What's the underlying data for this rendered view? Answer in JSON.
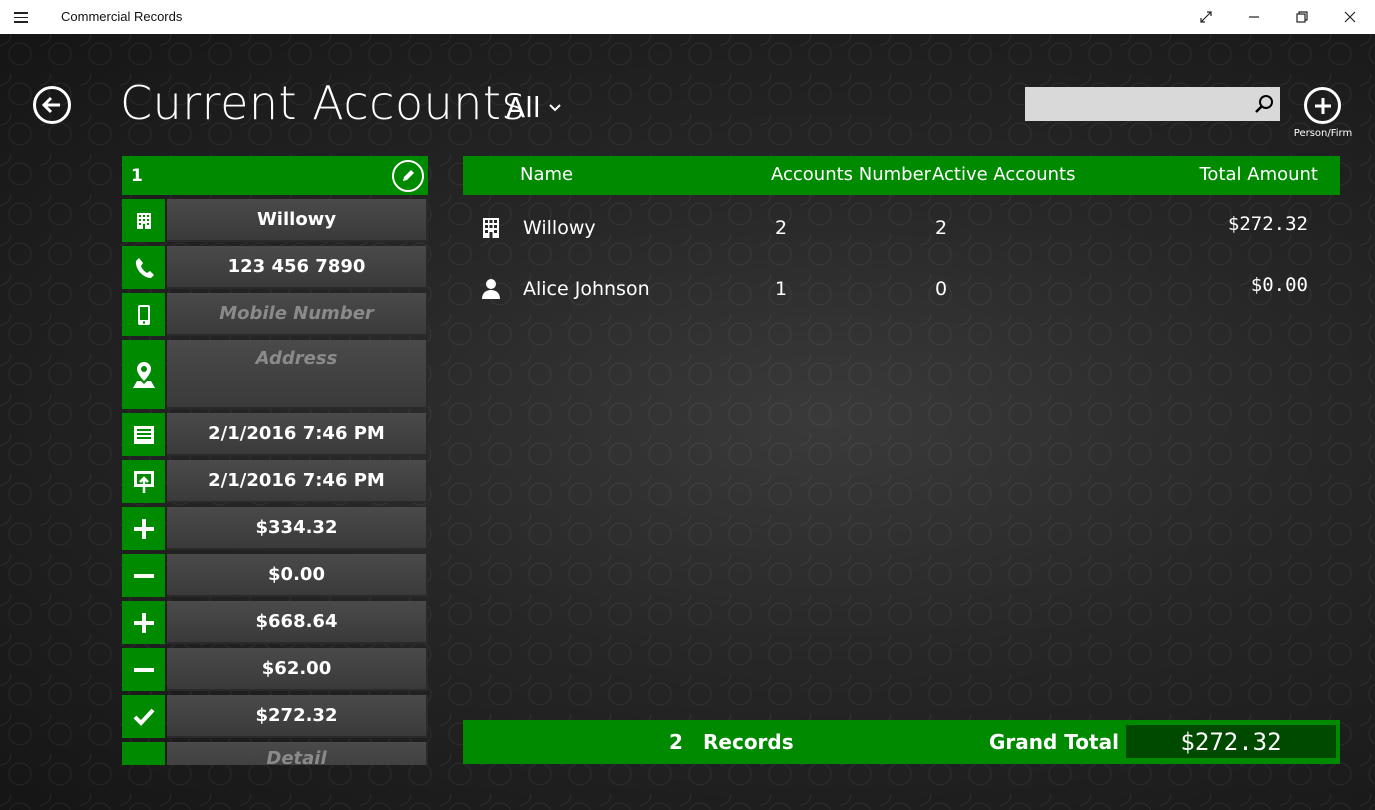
{
  "window": {
    "title": "Commercial Records",
    "icons": [
      "hamburger-icon",
      "expand-icon",
      "minimize-icon",
      "restore-icon",
      "close-icon"
    ]
  },
  "header": {
    "title": "Current Accounts",
    "filter": "All",
    "search_placeholder": "",
    "add_label": "Person/Firm"
  },
  "detail": {
    "id": "1",
    "name": "Willowy",
    "phone": "123 456 7890",
    "mobile_placeholder": "Mobile Number",
    "address_placeholder": "Address",
    "created": "2/1/2016 7:46 PM",
    "updated": "2/1/2016 7:46 PM",
    "credit1": "$334.32",
    "debit1": "$0.00",
    "credit2": "$668.64",
    "debit2": "$62.00",
    "balance": "$272.32",
    "detail_label": "Detail"
  },
  "table": {
    "columns": [
      "Name",
      "Accounts Number",
      "Active Accounts",
      "Total Amount"
    ],
    "rows": [
      {
        "type": "firm",
        "name": "Willowy",
        "accounts": "2",
        "active": "2",
        "amount": "$272.32"
      },
      {
        "type": "person",
        "name": "Alice  Johnson",
        "accounts": "1",
        "active": "0",
        "amount": "$0.00"
      }
    ]
  },
  "footer": {
    "count": "2",
    "records_label": "Records",
    "grand_label": "Grand Total",
    "grand_total": "$272.32"
  },
  "colors": {
    "accent": "#008a00",
    "accent_dark": "#004a00"
  }
}
